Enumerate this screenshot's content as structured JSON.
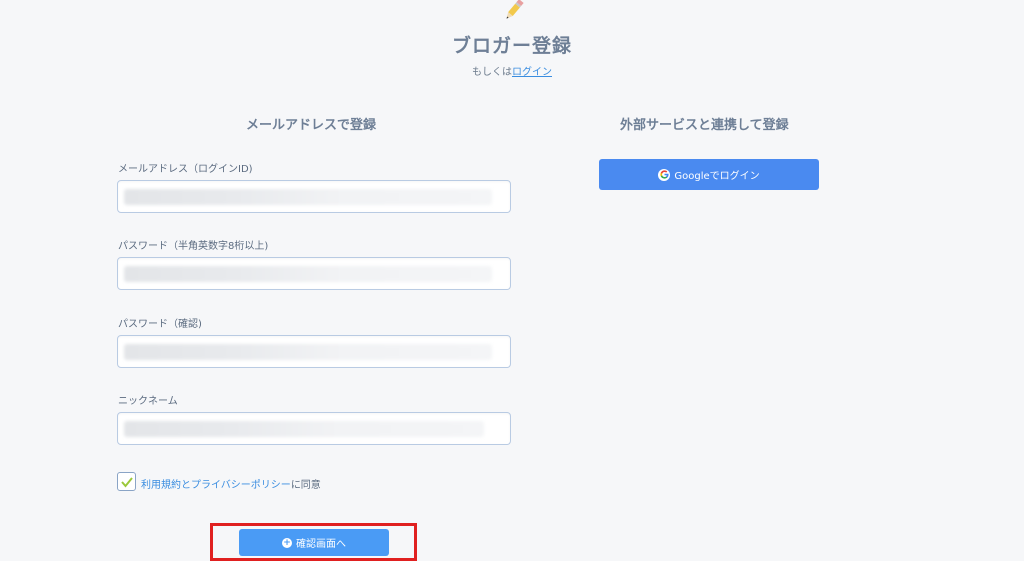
{
  "header": {
    "icon": "pencil-icon",
    "title": "ブロガー登録",
    "subtitle_prefix": "もしくは",
    "login_link": "ログイン"
  },
  "email_section": {
    "title": "メールアドレスで登録",
    "fields": [
      {
        "label": "メールアドレス（ログインID)",
        "value": ""
      },
      {
        "label": "パスワード（半角英数字8桁以上)",
        "value": ""
      },
      {
        "label": "パスワード（確認)",
        "value": ""
      },
      {
        "label": "ニックネーム",
        "value": ""
      }
    ],
    "agree": {
      "checked": true,
      "link_text": "利用規約とプライバシーポリシー",
      "suffix": "に同意"
    },
    "confirm_button": "確認画面へ"
  },
  "external_section": {
    "title": "外部サービスと連携して登録",
    "google_button": "Googleでログイン"
  },
  "colors": {
    "primary": "#4a9bf5",
    "highlight": "#e02020",
    "link": "#3a8de0"
  }
}
